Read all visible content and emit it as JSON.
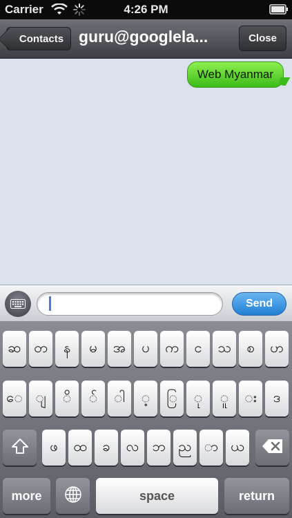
{
  "status_bar": {
    "carrier": "Carrier",
    "time": "4:26 PM",
    "battery_icon": "battery-full-icon",
    "wifi_icon": "wifi-icon",
    "activity_icon": "activity-spinner-icon"
  },
  "nav_bar": {
    "back_label": "Contacts",
    "title": "guru@googlela...",
    "close_label": "Close"
  },
  "messages": [
    {
      "text": "Web Myanmar",
      "from": "me",
      "color": "#5ed42f"
    }
  ],
  "input_bar": {
    "keyboard_toggle_icon": "keyboard-icon",
    "text_value": "",
    "send_label": "Send"
  },
  "keyboard": {
    "row1": [
      "ဆ",
      "တ",
      "န",
      "မ",
      "အ",
      "ပ",
      "က",
      "င",
      "သ",
      "စ",
      "ဟ"
    ],
    "row2": [
      "ေ",
      "ျ",
      "ိ",
      "် ",
      "ါ",
      "့",
      "ြ",
      "ု",
      "ူ",
      "း",
      "ဒ"
    ],
    "row3": [
      "ဖ",
      "ထ",
      "ခ",
      "လ",
      "ဘ",
      "ည",
      "ာ",
      "ယ"
    ],
    "shift_icon": "shift-arrow-icon",
    "delete_icon": "backspace-icon",
    "more_label": "more",
    "globe_icon": "globe-icon",
    "space_label": "space",
    "return_label": "return"
  },
  "colors": {
    "send_button": "#2d8fe0",
    "bubble": "#5ed42f",
    "messages_bg": "#dbe2ed"
  }
}
